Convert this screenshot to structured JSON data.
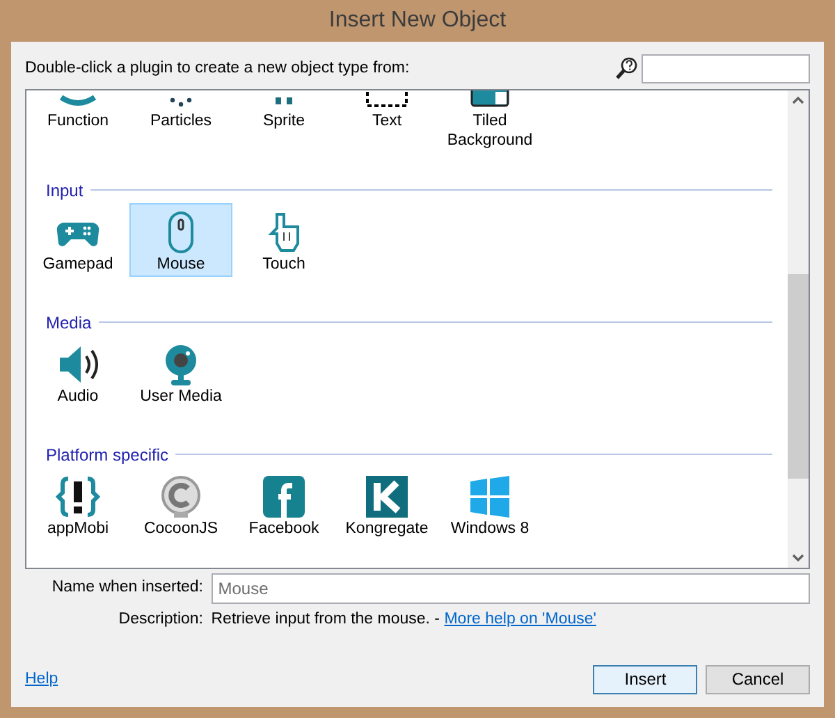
{
  "window": {
    "title": "Insert New Object"
  },
  "instruction": "Double-click a plugin to create a new object type from:",
  "partial_row": {
    "items": [
      {
        "label": "Function",
        "selected": false
      },
      {
        "label": "Particles",
        "selected": false
      },
      {
        "label": "Sprite",
        "selected": false
      },
      {
        "label": "Text",
        "selected": false
      },
      {
        "label": "Tiled Background",
        "selected": false
      }
    ]
  },
  "groups": [
    {
      "heading": "Input",
      "items": [
        {
          "label": "Gamepad",
          "selected": false
        },
        {
          "label": "Mouse",
          "selected": true
        },
        {
          "label": "Touch",
          "selected": false
        }
      ]
    },
    {
      "heading": "Media",
      "items": [
        {
          "label": "Audio",
          "selected": false
        },
        {
          "label": "User Media",
          "selected": false
        }
      ]
    },
    {
      "heading": "Platform specific",
      "items": [
        {
          "label": "appMobi",
          "selected": false
        },
        {
          "label": "CocoonJS",
          "selected": false
        },
        {
          "label": "Facebook",
          "selected": false
        },
        {
          "label": "Kongregate",
          "selected": false
        },
        {
          "label": "Windows 8",
          "selected": false
        }
      ]
    }
  ],
  "name_field": {
    "label": "Name when inserted:",
    "value": "Mouse"
  },
  "description": {
    "label": "Description:",
    "text": "Retrieve input from the mouse. - ",
    "link": "More help on 'Mouse'"
  },
  "help_link": "Help",
  "buttons": [
    {
      "label": "Insert",
      "default": true
    },
    {
      "label": "Cancel",
      "default": false
    }
  ]
}
